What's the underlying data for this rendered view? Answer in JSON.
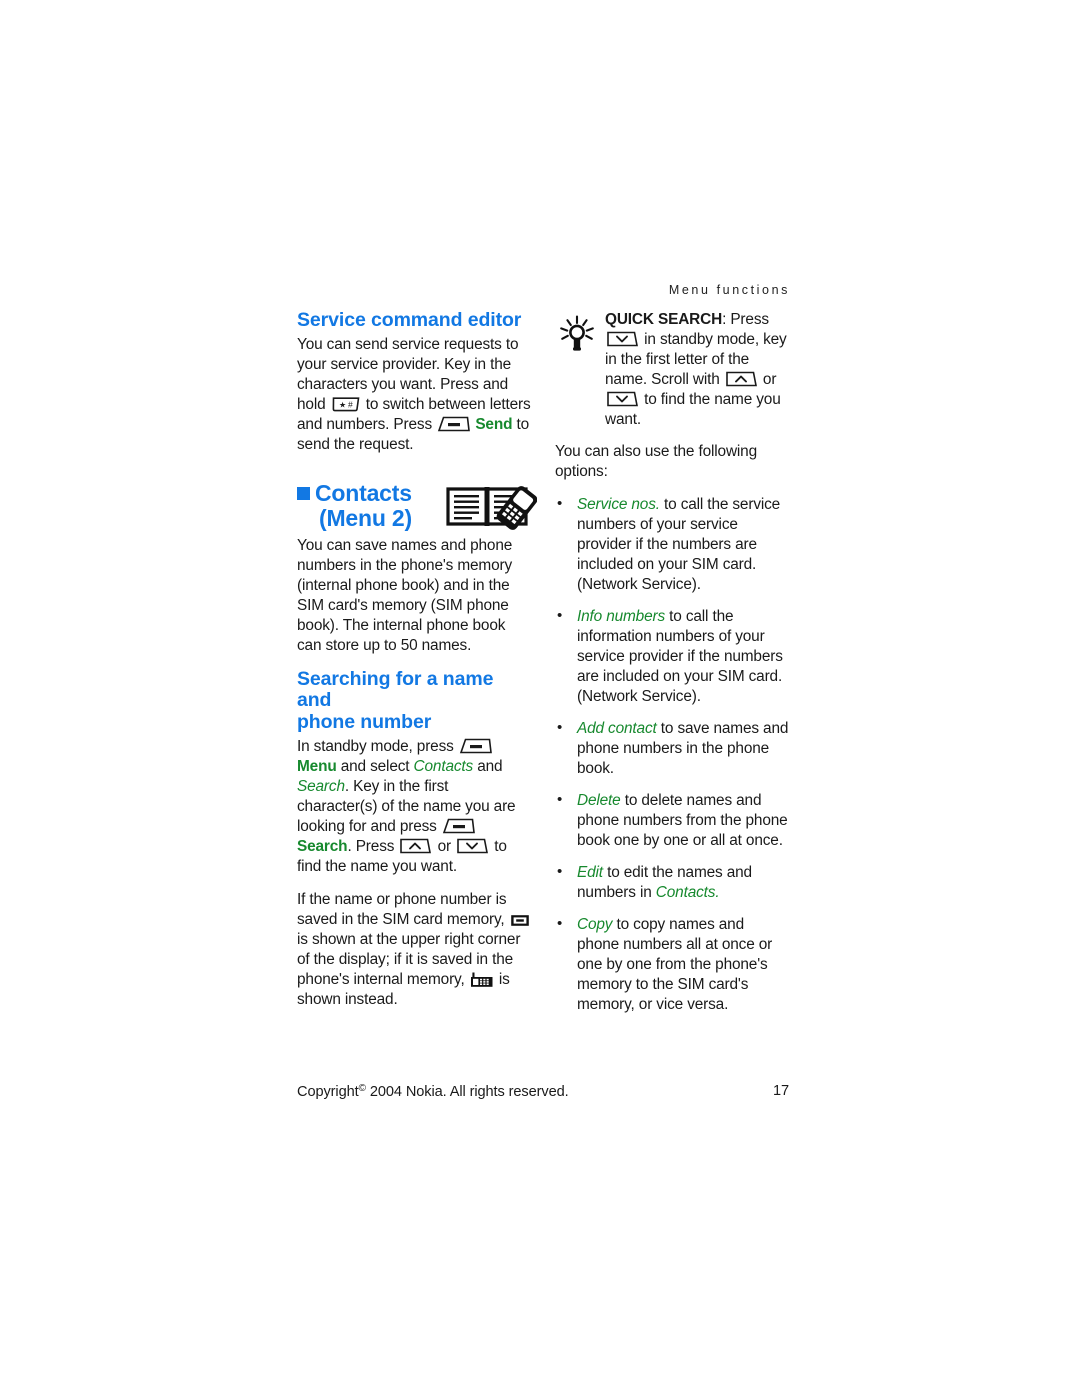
{
  "header": {
    "running_head": "Menu functions"
  },
  "left_column": {
    "service_editor": {
      "heading": "Service command editor",
      "para_1a": "You can send service requests to your service provider. Key in the characters you want. Press and hold",
      "para_1b": "to switch between letters and numbers. Press",
      "para_1c": "Send",
      "para_1d": "to send the request."
    },
    "contacts": {
      "heading_line1": "Contacts",
      "heading_line2": "(Menu 2)",
      "icon": "contacts-book-phone-icon",
      "para": "You can save names and phone numbers in the phone's memory (internal phone book) and in the SIM card's memory (SIM phone book). The internal phone book can store up to 50 names."
    },
    "searching": {
      "heading_line1": "Searching for a name and",
      "heading_line2": "phone number",
      "p1_a": "In standby mode, press",
      "p1_menu": "Menu",
      "p1_b": "and select",
      "p1_contacts": "Contacts",
      "p1_c": "and",
      "p1_search_italic": "Search",
      "p1_d": ". Key in the first character(s) of the name you are looking for and press",
      "p1_search_bold": "Search",
      "p1_e": ". Press",
      "p1_or": "or",
      "p1_f": "to find the name you want.",
      "p2_a": "If the name or phone number is saved in the SIM card memory,",
      "p2_b": "is shown at the upper right corner of the display; if it is saved in the phone's internal memory,",
      "p2_c": "is shown instead."
    }
  },
  "right_column": {
    "tip": {
      "icon": "light-bulb-icon",
      "label": "QUICK SEARCH",
      "a": ": Press",
      "b": "in standby mode, key in the first letter of the name. Scroll with",
      "or": "or",
      "c": "to find the name you want."
    },
    "options_intro": "You can also use the following options:",
    "options": [
      {
        "term": "Service nos.",
        "text": "to call the service numbers of your service provider if the numbers are included on your SIM card. (Network Service)."
      },
      {
        "term": "Info numbers",
        "text": "to call the information numbers of your service provider if the numbers are included on your SIM card. (Network Service)."
      },
      {
        "term": "Add contact",
        "text": "to save names and phone numbers in the phone book."
      },
      {
        "term": "Delete",
        "text": "to delete names and phone numbers from the phone book one by one or all at once."
      },
      {
        "term": "Edit",
        "text_a": "to edit the names and numbers in",
        "term_2": "Contacts",
        "text_b": "."
      },
      {
        "term": "Copy",
        "text": "to copy names and phone numbers all at once or one by one from the phone's memory to the SIM card's memory, or vice versa."
      }
    ]
  },
  "footer": {
    "copyright_pre": "Copyright",
    "copyright_mark": "©",
    "copyright_post": "2004 Nokia. All rights reserved.",
    "page_number": "17"
  },
  "colors": {
    "heading_blue": "#1278e3",
    "accent_green": "#17892e",
    "body_text": "#1a1a1a"
  },
  "icons": {
    "star_hash_key": "star-hash-key-icon",
    "softkey": "softkey-icon",
    "scroll_up_key": "scroll-up-key-icon",
    "scroll_down_key": "scroll-down-key-icon",
    "sim_memory": "sim-card-memory-icon",
    "phone_memory": "phone-internal-memory-icon"
  }
}
